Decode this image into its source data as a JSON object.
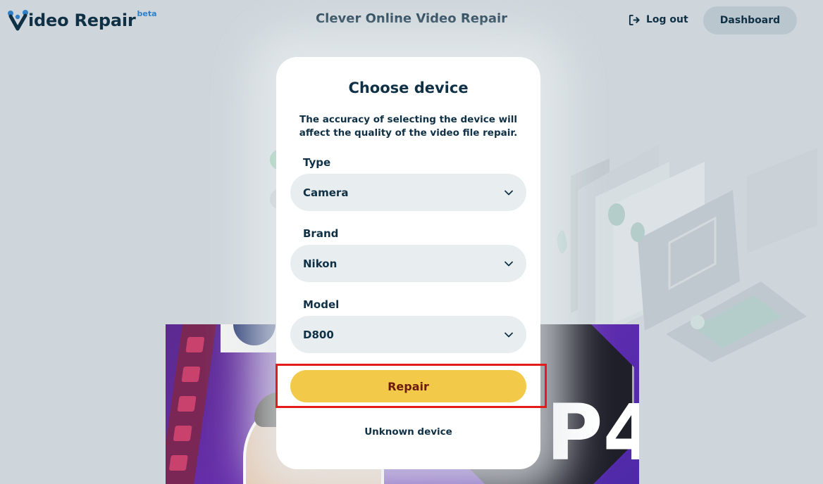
{
  "header": {
    "logo_text": "ideo Repair",
    "logo_badge": "beta",
    "title": "Clever Online Video Repair",
    "logout_label": "Log out",
    "dashboard_label": "Dashboard"
  },
  "modal": {
    "title": "Choose device",
    "description": "The accuracy of selecting the device will affect the quality of the video file repair.",
    "fields": [
      {
        "label": "Type",
        "value": "Camera"
      },
      {
        "label": "Brand",
        "value": "Nikon"
      },
      {
        "label": "Model",
        "value": "D800"
      }
    ],
    "repair_label": "Repair",
    "unknown_label": "Unknown device"
  },
  "thumbnail": {
    "big_text": "P4"
  },
  "colors": {
    "accent_yellow": "#f3c94a",
    "highlight_red": "#e21b1b",
    "navy": "#0f3045",
    "brand_blue": "#2f7fc9"
  },
  "icons": {
    "logout": "logout-icon",
    "chevron": "chevron-down-icon"
  }
}
